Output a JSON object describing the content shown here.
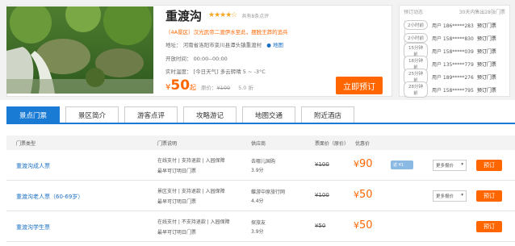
{
  "scenic": {
    "title": "重渡沟",
    "stars": "★★★★☆",
    "comments": "共有8条点评",
    "level_line": "（4A景区）汉光武帝二渡伊水至此，摆脱王莽的追兵",
    "address": "地址：  河南省洛阳市栾川县潭头镇重渡村",
    "map": "地图",
    "hours": "开放时间：  00:00--00:00",
    "weather": "实时温度：  [今日天气]  多云转晴        5 ~ -3°C",
    "price_symbol": "¥",
    "price": "50",
    "price_suffix": "起",
    "orig_label": "原价：",
    "orig_price": "¥100",
    "discount": "5.0 折",
    "book_label": "立即预订"
  },
  "panel": {
    "title": "预订动态",
    "summary": "30天内售出28张门票",
    "feed": [
      {
        "ago": "2小时前",
        "user": "用户 186*****283",
        "act": "预订门票"
      },
      {
        "ago": "2小时前",
        "user": "用户 158*****830",
        "act": "预订门票"
      },
      {
        "ago": "15分钟前",
        "user": "用户 158*****039",
        "act": "预订门票"
      },
      {
        "ago": "18分钟前",
        "user": "用户 135*****779",
        "act": "预订门票"
      },
      {
        "ago": "25分钟前",
        "user": "用户 189*****276",
        "act": "预订门票"
      },
      {
        "ago": "28分钟前",
        "user": "用户 158*****795",
        "act": "预订门票"
      }
    ]
  },
  "tabs": [
    "景点门票",
    "景区简介",
    "游客点评",
    "攻略游记",
    "地图交通",
    "附近酒店"
  ],
  "table": {
    "headers": [
      "门票类型",
      "门票说明",
      "供应商",
      "票面价（原价）",
      "优惠价"
    ],
    "rows": [
      {
        "name": "重渡沟成人票",
        "desc1": "在线支付  |  支持退款  |  入园保障",
        "desc2": "最早可订明日门票",
        "vendor": "去哪儿国购",
        "score": "3.9分",
        "orig": "¥100",
        "price_sym": "¥",
        "price": "90",
        "badge": "返 ¥1",
        "more": "更多报价",
        "book": "预订"
      },
      {
        "name": "重渡沟老人票（60-69岁）",
        "desc1": "景区支付  |  支持退款  |  入园保障",
        "desc2": "最早可订明日门票",
        "vendor": "蝶游中原旅行网",
        "score": "4.4分",
        "orig": "¥100",
        "price_sym": "¥",
        "price": "50",
        "badge": "",
        "more": "更多报价",
        "book": "预订"
      },
      {
        "name": "重渡沟学生票",
        "desc1": "在线支付  |  不支持退款  |  入园保障",
        "desc2": "最早可订明日门票",
        "vendor": "探旅友",
        "score": "3.9分",
        "orig": "¥50",
        "price_sym": "¥",
        "price": "50",
        "badge": "",
        "more": "",
        "book": "预订"
      }
    ]
  },
  "colors": {
    "accent_blue": "#1a7bd4",
    "orange": "#ff6600",
    "star": "#f5a623"
  }
}
